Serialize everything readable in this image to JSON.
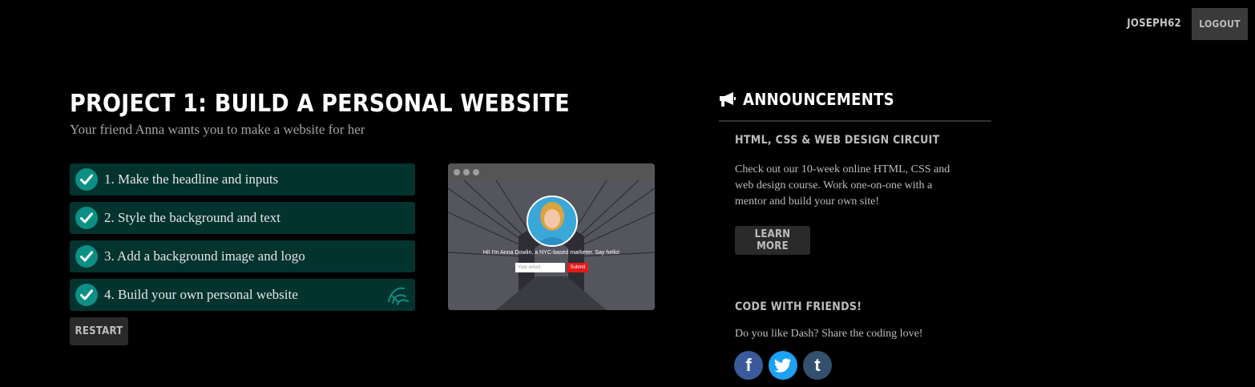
{
  "header": {
    "username": "JOSEPH62",
    "logout_label": "LOGOUT"
  },
  "project": {
    "title": "PROJECT 1: BUILD A PERSONAL WEBSITE",
    "subtitle": "Your friend Anna wants you to make a website for her",
    "tasks": [
      {
        "label": "1. Make the headline and inputs",
        "completed": true
      },
      {
        "label": "2. Style the background and text",
        "completed": true
      },
      {
        "label": "3. Add a background image and logo",
        "completed": true
      },
      {
        "label": "4. Build your own personal website",
        "completed": true,
        "badge_icon": "badge-icon"
      }
    ],
    "restart_label": "RESTART",
    "preview": {
      "intro": "Hi! I'm Anna Dowlin, a NYC-based marketer. Say hello!",
      "email_placeholder": "Your email",
      "submit_label": "Submit"
    }
  },
  "announcements": {
    "title": "ANNOUNCEMENTS",
    "circuit_title": "HTML, CSS & WEB DESIGN CIRCUIT",
    "circuit_text": "Check out our 10-week online HTML, CSS and web design course. Work one-on-one with a mentor and build your own site!",
    "learn_more_label": "LEARN MORE",
    "friends_title": "CODE WITH FRIENDS!",
    "friends_text": "Do you like Dash? Share the coding love!",
    "social": [
      "facebook-icon",
      "twitter-icon",
      "tumblr-icon"
    ]
  },
  "colors": {
    "task_bg": "#03332f",
    "check": "#0c8f84",
    "facebook": "#3b5a9b",
    "twitter": "#1da1f2",
    "tumblr": "#34506f"
  }
}
